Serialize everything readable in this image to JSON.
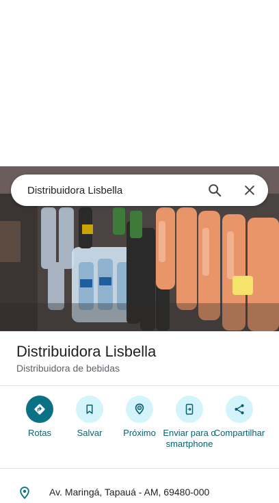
{
  "search": {
    "query": "Distribuidora Lisbella"
  },
  "place": {
    "name": "Distribuidora Lisbella",
    "category": "Distribuidora de bebidas",
    "address": "Av. Maringá, Tapauá - AM, 69480-000"
  },
  "actions": [
    {
      "label": "Rotas",
      "icon": "directions-icon"
    },
    {
      "label": "Salvar",
      "icon": "bookmark-icon"
    },
    {
      "label": "Próximo",
      "icon": "nearby-icon"
    },
    {
      "label": "Enviar para o smartphone",
      "icon": "send-to-phone-icon"
    },
    {
      "label": "Compartilhar",
      "icon": "share-icon"
    }
  ],
  "colors": {
    "accent": "#0b7285",
    "action_bg": "#d3f4fa",
    "label": "#0a5f72"
  }
}
